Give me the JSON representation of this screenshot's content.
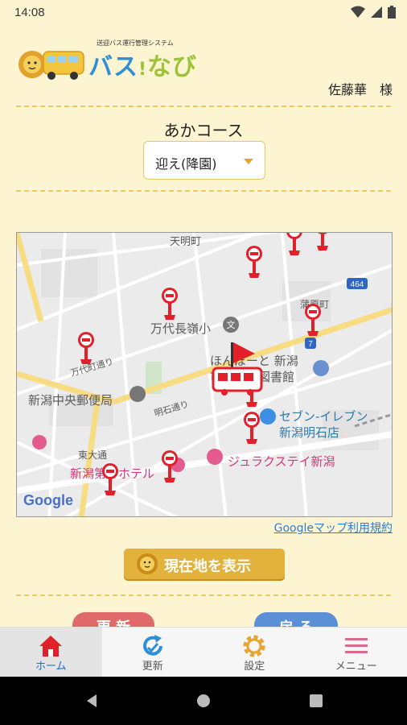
{
  "status_bar": {
    "time": "14:08"
  },
  "header": {
    "logo_subtitle": "送迎バス運行管理システム",
    "logo_text_1": "バス",
    "logo_text_2": "なび",
    "user_name": "佐藤華　様"
  },
  "course": {
    "name": "あかコース",
    "selected": "迎え(降園)"
  },
  "map": {
    "labels": {
      "tenmeicho": "天明町",
      "bandai": "万代長嶺小",
      "hompo_1": "ほんぽーと 新潟",
      "hompo_2": "市立中央図書館",
      "post": "新潟中央郵便局",
      "meiseki": "明石通り",
      "seven_1": "セブン-イレブン",
      "seven_2": "新潟明石店",
      "higashi": "東大通",
      "hotel": "新潟第一ホテル",
      "jurak": "ジュラクステイ新潟",
      "kamadori": "万代町通り",
      "gamahara": "蒲原町",
      "route_464": "464",
      "route_7": "7",
      "google": "Google"
    }
  },
  "map_terms": "Googleマップ利用規約",
  "location_button": "現在地を表示",
  "peek_buttons": {
    "update": "更 新",
    "back": "戻 る"
  },
  "tabs": [
    {
      "label": "ホーム"
    },
    {
      "label": "更新"
    },
    {
      "label": "設定"
    },
    {
      "label": "メニュー"
    }
  ],
  "colors": {
    "background": "#fdf4d2",
    "accent": "#e2b23c",
    "stop_red": "#e1202a",
    "tab_active": "#1f6fd1"
  }
}
